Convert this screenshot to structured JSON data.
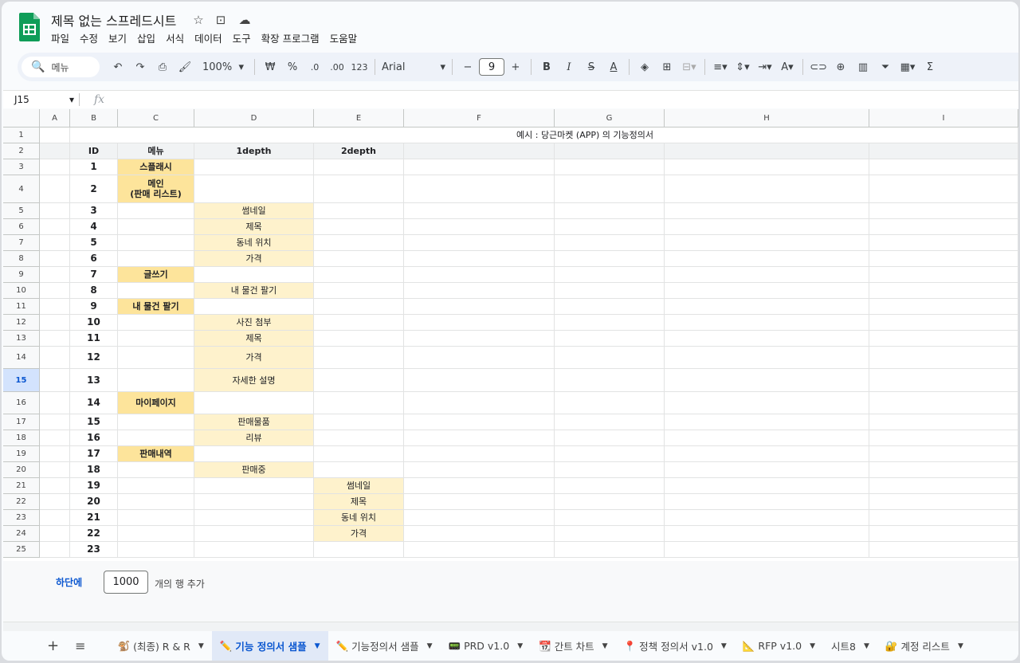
{
  "app": {
    "title": "제목 없는 스프레드시트",
    "colors": {
      "accent": "#0b57d0",
      "menu_yellow": "#fde49b",
      "sub_yellow": "#fef2cc",
      "sheets_green": "#0f9d58"
    }
  },
  "menu": [
    "파일",
    "수정",
    "보기",
    "삽입",
    "서식",
    "데이터",
    "도구",
    "확장 프로그램",
    "도움말"
  ],
  "toolbar": {
    "search": "메뉴",
    "zoom": "100%",
    "currency": "₩",
    "percent": "%",
    "dec_less": ".0",
    "dec_more": ".00",
    "number_format": "123",
    "font": "Arial",
    "font_size": "9"
  },
  "formula_bar": {
    "cell_ref": "J15",
    "fx": "fx",
    "value": ""
  },
  "grid": {
    "columns": [
      "A",
      "B",
      "C",
      "D",
      "E",
      "F",
      "G",
      "H",
      "I"
    ],
    "selected_row": "15",
    "title_text": "예시 : 당근마켓 (APP) 의 기능정의서",
    "headers": {
      "id": "ID",
      "menu": "메뉴",
      "d1": "1depth",
      "d2": "2depth"
    },
    "rows": [
      {
        "n": "1",
        "id": "",
        "menu": "",
        "d1": "",
        "d2": ""
      },
      {
        "n": "2",
        "id": "",
        "menu": "",
        "d1": "",
        "d2": ""
      },
      {
        "n": "3",
        "id": "1",
        "menu": "스플래시",
        "d1": "",
        "d2": ""
      },
      {
        "n": "4",
        "id": "2",
        "menu": "메인\n(판매 리스트)",
        "d1": "",
        "d2": ""
      },
      {
        "n": "5",
        "id": "3",
        "menu": "",
        "d1": "썸네일",
        "d2": ""
      },
      {
        "n": "6",
        "id": "4",
        "menu": "",
        "d1": "제목",
        "d2": ""
      },
      {
        "n": "7",
        "id": "5",
        "menu": "",
        "d1": "동네 위치",
        "d2": ""
      },
      {
        "n": "8",
        "id": "6",
        "menu": "",
        "d1": "가격",
        "d2": ""
      },
      {
        "n": "9",
        "id": "7",
        "menu": "글쓰기",
        "d1": "",
        "d2": ""
      },
      {
        "n": "10",
        "id": "8",
        "menu": "",
        "d1": "내 물건 팔기",
        "d2": ""
      },
      {
        "n": "11",
        "id": "9",
        "menu": "내 물건 팔기",
        "d1": "",
        "d2": ""
      },
      {
        "n": "12",
        "id": "10",
        "menu": "",
        "d1": "사진 첨부",
        "d2": ""
      },
      {
        "n": "13",
        "id": "11",
        "menu": "",
        "d1": "제목",
        "d2": ""
      },
      {
        "n": "14",
        "id": "12",
        "menu": "",
        "d1": "가격",
        "d2": ""
      },
      {
        "n": "15",
        "id": "13",
        "menu": "",
        "d1": "자세한 설명",
        "d2": ""
      },
      {
        "n": "16",
        "id": "14",
        "menu": "마이페이지",
        "d1": "",
        "d2": ""
      },
      {
        "n": "17",
        "id": "15",
        "menu": "",
        "d1": "판매물품",
        "d2": ""
      },
      {
        "n": "18",
        "id": "16",
        "menu": "",
        "d1": "리뷰",
        "d2": ""
      },
      {
        "n": "19",
        "id": "17",
        "menu": "판매내역",
        "d1": "",
        "d2": ""
      },
      {
        "n": "20",
        "id": "18",
        "menu": "",
        "d1": "판매중",
        "d2": ""
      },
      {
        "n": "21",
        "id": "19",
        "menu": "",
        "d1": "",
        "d2": "썸네일"
      },
      {
        "n": "22",
        "id": "20",
        "menu": "",
        "d1": "",
        "d2": "제목"
      },
      {
        "n": "23",
        "id": "21",
        "menu": "",
        "d1": "",
        "d2": "동네 위치"
      },
      {
        "n": "24",
        "id": "22",
        "menu": "",
        "d1": "",
        "d2": "가격"
      },
      {
        "n": "25",
        "id": "23",
        "menu": "",
        "d1": "",
        "d2": ""
      }
    ]
  },
  "bottom": {
    "add_link": "하단에",
    "rows_value": "1000",
    "rows_label": "개의 행 추가"
  },
  "sheets": {
    "active_index": 1,
    "tabs": [
      {
        "icon": "🐒",
        "label": "(최종) R & R"
      },
      {
        "icon": "✏️",
        "label": "기능 정의서 샘플"
      },
      {
        "icon": "✏️",
        "label": "기능정의서 샘플"
      },
      {
        "icon": "📟",
        "label": "PRD v1.0"
      },
      {
        "icon": "📆",
        "label": "간트 차트"
      },
      {
        "icon": "📍",
        "label": "정책 정의서 v1.0"
      },
      {
        "icon": "📐",
        "label": "RFP v1.0"
      },
      {
        "icon": "",
        "label": "시트8"
      },
      {
        "icon": "🔐",
        "label": "계정 리스트"
      }
    ]
  }
}
